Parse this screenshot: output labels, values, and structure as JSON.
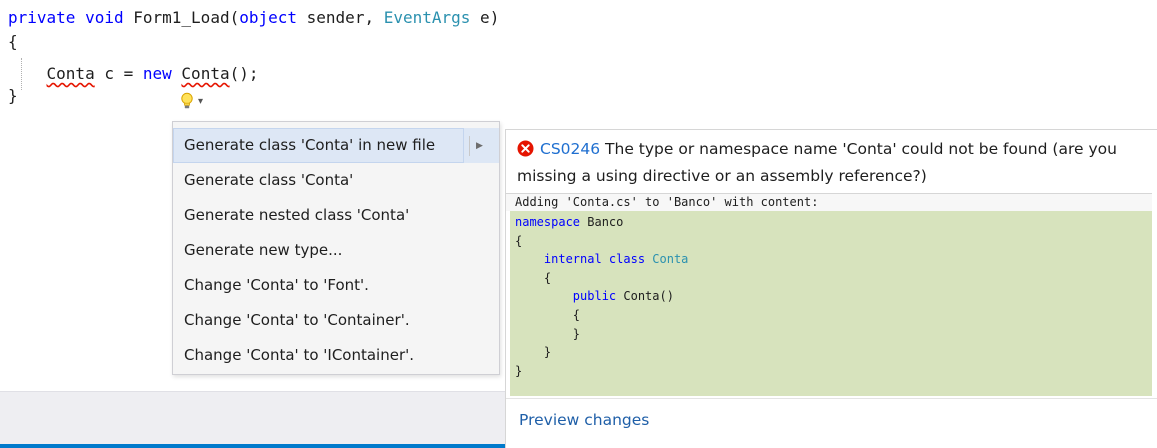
{
  "editor": {
    "line1": {
      "kw1": "private",
      "kw2": "void",
      "name": "Form1_Load(",
      "kw3": "object",
      "param1": " sender, ",
      "type1": "EventArgs",
      "param2": " e)"
    },
    "line2": "{",
    "line3": {
      "type": "Conta",
      "mid": " c = ",
      "kw": "new",
      "ctor": "Conta",
      "end": "();"
    },
    "line4": "}"
  },
  "lightbulb": {
    "icon": "lightbulb-icon",
    "dropdown_glyph": "▾"
  },
  "menu": {
    "items": [
      "Generate class 'Conta' in new file",
      "Generate class 'Conta'",
      "Generate nested class 'Conta'",
      "Generate new type...",
      "Change 'Conta' to 'Font'.",
      "Change 'Conta' to 'Container'.",
      "Change 'Conta' to 'IContainer'."
    ],
    "selected_index": 0,
    "submenu_arrow": "▶"
  },
  "preview": {
    "error_code": "CS0246",
    "error_message": "The type or namespace name 'Conta' could not be found (are you missing a using directive or an assembly reference?)",
    "adding_text": "Adding 'Conta.cs' to 'Banco' with content:",
    "code": {
      "ns_kw": "namespace",
      "ns_name": " Banco",
      "open1": "{",
      "cls_kw": "    internal class ",
      "cls_name": "Conta",
      "open2": "    {",
      "ctor_kw": "        public",
      "ctor_name": " Conta()",
      "open3": "        {",
      "close3": "        }",
      "close2": "    }",
      "close1": "}"
    },
    "link": "Preview changes"
  },
  "colors": {
    "keyword": "#0000ff",
    "type": "#2b91af",
    "error": "#e51400",
    "preview_bg": "#d7e3bd",
    "link": "#1f5fa8",
    "accent": "#007acc"
  }
}
